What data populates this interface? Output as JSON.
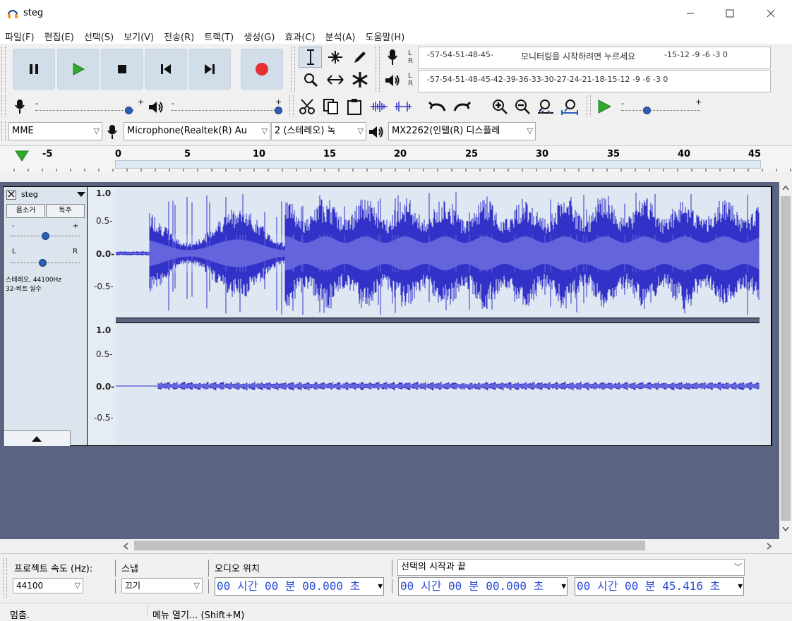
{
  "window": {
    "title": "steg"
  },
  "menu": [
    "파일(F)",
    "편집(E)",
    "선택(S)",
    "보기(V)",
    "전송(R)",
    "트랙(T)",
    "생성(G)",
    "효과(C)",
    "분석(A)",
    "도움말(H)"
  ],
  "meters": {
    "record_scale": "-57-54-51-48-45-",
    "record_prompt": "모니터링을 시작하려면 누르세요",
    "record_scale_tail": "-15-12 -9 -6 -3 0",
    "play_scale": "-57-54-51-48-45-42-39-36-33-30-27-24-21-18-15-12 -9 -6 -3 0",
    "l": "L",
    "r": "R"
  },
  "devices": {
    "host": "MME",
    "input": "Microphone(Realtek(R) Au",
    "channels": "2 (스테레오) 녹",
    "output": "MX2262(인텔(R) 디스플레"
  },
  "ruler": {
    "labels": [
      "-5",
      "0",
      "5",
      "10",
      "15",
      "20",
      "25",
      "30",
      "35",
      "40",
      "45"
    ]
  },
  "track": {
    "name": "steg",
    "mute": "음소거",
    "solo": "독주",
    "gain_minus": "-",
    "gain_plus": "+",
    "pan_l": "L",
    "pan_r": "R",
    "info1": "스테레오, 44100Hz",
    "info2": "32-비트 실수",
    "scale": [
      "1.0",
      "0.5-",
      "0.0-",
      "-0.5-"
    ]
  },
  "selection": {
    "rate_label": "프로젝트 속도 (Hz):",
    "rate_value": "44100",
    "snap_label": "스냅",
    "snap_value": "끄기",
    "pos_label": "오디오 위치",
    "sel_label": "선택의 시작과 끝",
    "pos_time": "00 시간 00 분 00.000 초",
    "sel_start": "00 시간 00 분 00.000 초",
    "sel_end": "00 시간 00 분 45.416 초"
  },
  "status": {
    "left": "멈춤.",
    "right": "메뉴 열기... (Shift+M)"
  },
  "colors": {
    "waveform": "#3232c8",
    "waveform_rms": "#6464dc",
    "wave_bg": "#dfe7f3",
    "record": "#e53030",
    "play": "#2daa2d"
  }
}
